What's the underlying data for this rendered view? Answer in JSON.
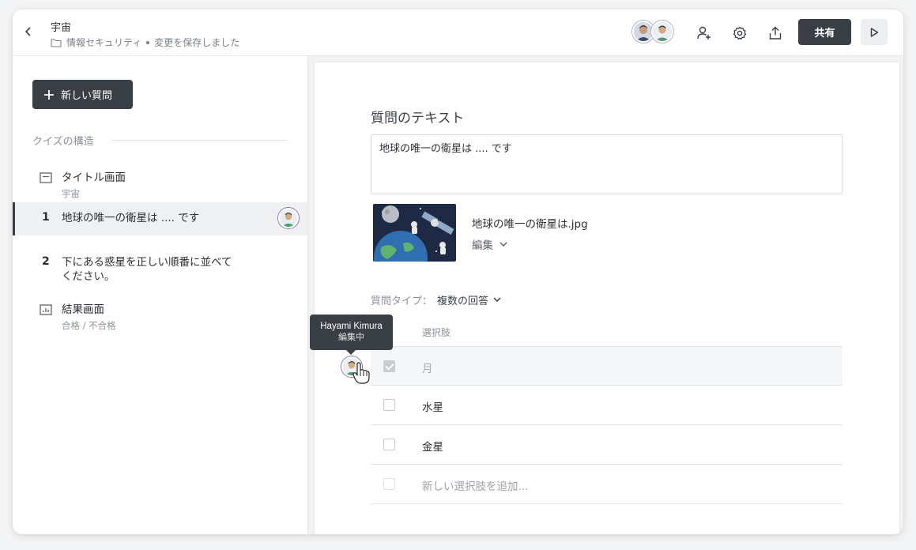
{
  "header": {
    "title": "宇宙",
    "folder": "情報セキュリティ",
    "save_status": "変更を保存しました",
    "share_label": "共有"
  },
  "sidebar": {
    "new_question_label": "新しい質問",
    "section_label": "クイズの構造",
    "items": [
      {
        "title": "タイトル画面",
        "subtitle": "宇宙"
      },
      {
        "number": "1",
        "title": "地球の唯一の衛星は .... です"
      },
      {
        "number": "2",
        "title_line1": "下にある惑星を正しい順番に並べて",
        "title_line2": "ください。"
      },
      {
        "title": "結果画面",
        "subtitle": "合格 / 不合格"
      }
    ]
  },
  "editor": {
    "question_label": "質問のテキスト",
    "question_text": "地球の唯一の衛星は .... です",
    "image_name": "地球の唯一の衛星は.jpg",
    "image_edit_label": "編集",
    "question_type_label": "質問タイプ：",
    "question_type_value": "複数の回答",
    "options_header": "選択肢",
    "options": [
      {
        "label": "月",
        "checked": true
      },
      {
        "label": "水星",
        "checked": false
      },
      {
        "label": "金星",
        "checked": false
      }
    ],
    "add_option_placeholder": "新しい選択肢を追加..."
  },
  "tooltip": {
    "name": "Hayami Kimura",
    "status": "編集中"
  },
  "colors": {
    "primary_dark": "#3a3f45",
    "avatar_green": "#4f9a6e",
    "avatar_ring": "#8a6fb5"
  }
}
